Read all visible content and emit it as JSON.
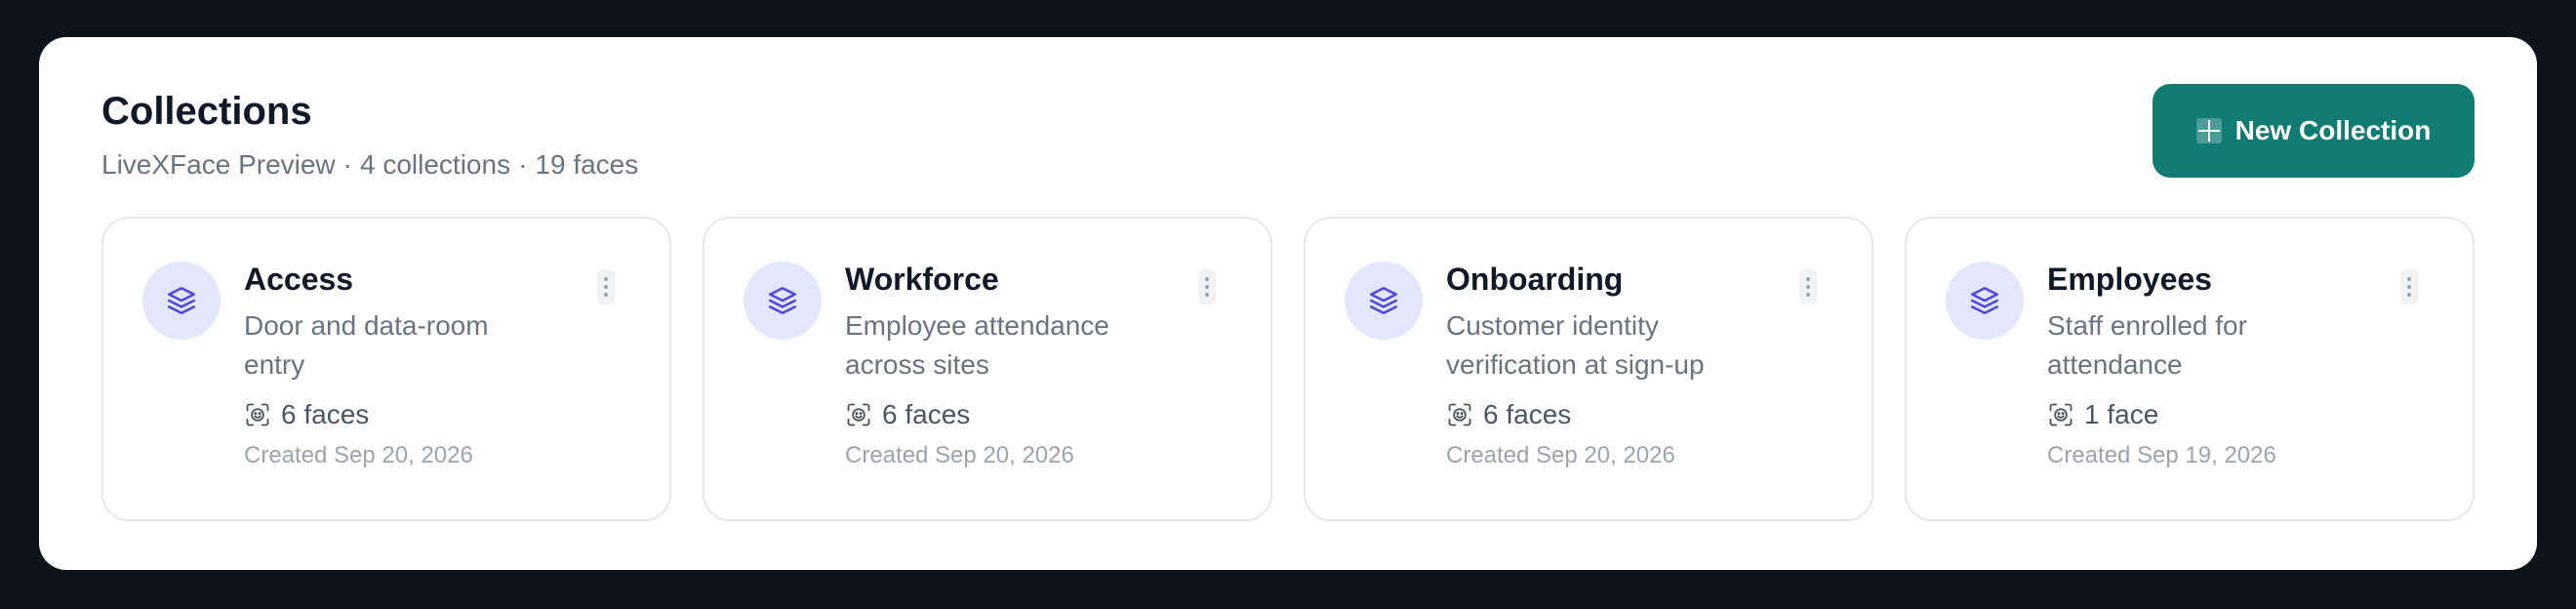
{
  "header": {
    "title": "Collections",
    "workspace": "LiveXFace Preview",
    "separator": "·",
    "collections_count": "4 collections",
    "faces_count": "19 faces"
  },
  "actions": {
    "new_collection_label": "New Collection"
  },
  "colors": {
    "primary": "#0f7b73",
    "icon_bg": "#e4e7fb",
    "icon_fg": "#4f46e5"
  },
  "collections": [
    {
      "name": "Access",
      "description": "Door and data-room entry",
      "faces": "6 faces",
      "created": "Created Sep 20, 2026",
      "icon": "layers-icon"
    },
    {
      "name": "Workforce",
      "description": "Employee attendance across sites",
      "faces": "6 faces",
      "created": "Created Sep 20, 2026",
      "icon": "layers-icon"
    },
    {
      "name": "Onboarding",
      "description": "Customer identity verification at sign-up",
      "faces": "6 faces",
      "created": "Created Sep 20, 2026",
      "icon": "layers-icon"
    },
    {
      "name": "Employees",
      "description": "Staff enrolled for attendance",
      "faces": "1 face",
      "created": "Created Sep 19, 2026",
      "icon": "layers-icon"
    }
  ]
}
